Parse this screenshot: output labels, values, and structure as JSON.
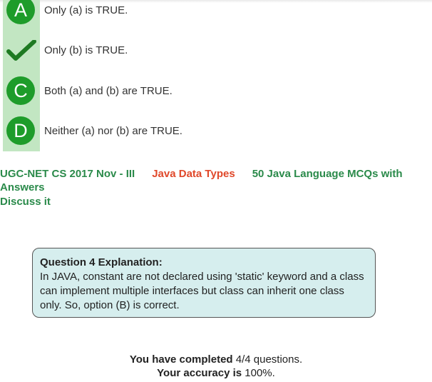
{
  "options": [
    {
      "letter": "A",
      "text": "Only (a) is TRUE.",
      "correct": false
    },
    {
      "letter": "",
      "text": "Only (b) is TRUE.",
      "correct": true,
      "icon": "checkmark-icon"
    },
    {
      "letter": "C",
      "text": "Both (a) and (b) are TRUE.",
      "correct": false
    },
    {
      "letter": "D",
      "text": "Neither (a) nor (b) are TRUE.",
      "correct": false
    }
  ],
  "tags": {
    "exam": "UGC-NET CS 2017 Nov - III",
    "topic": "Java Data Types",
    "series": "50 Java Language MCQs with Answers"
  },
  "discuss": "Discuss it",
  "explanation": {
    "title": "Question 4 Explanation:",
    "body": "In JAVA, constant are not declared using 'static' keyword and a class can implement multiple interfaces but class can inherit one class only. So, option (B) is correct."
  },
  "summary": {
    "completed_prefix": "You have completed",
    "completed_value": "4/4",
    "completed_suffix": "questions.",
    "accuracy_prefix": "Your accuracy is",
    "accuracy_value": "100%."
  },
  "colors": {
    "badge": "#1e9c2a",
    "strip": "#c2e6c2",
    "tag_green": "#2a8a4a",
    "tag_red": "#e0482a",
    "explain_bg": "#d6eeee"
  }
}
